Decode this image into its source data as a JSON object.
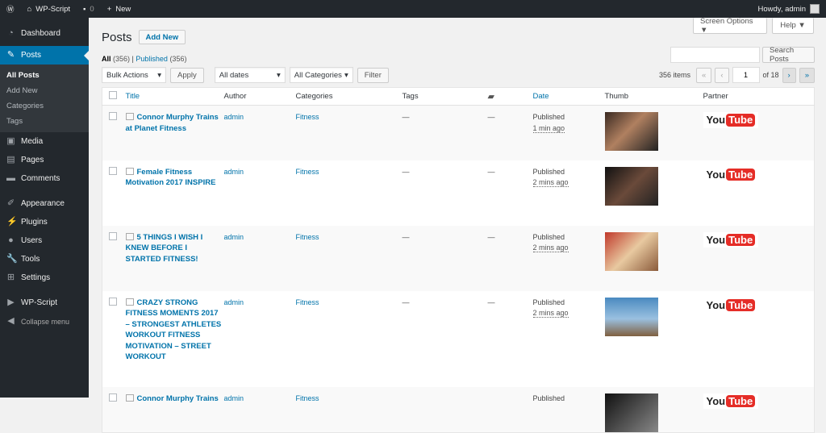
{
  "adminbar": {
    "site": "WP-Script",
    "comments": "0",
    "new": "New",
    "howdy": "Howdy, admin"
  },
  "sidebar": {
    "items": [
      "Dashboard",
      "Posts",
      "Media",
      "Pages",
      "Comments",
      "Appearance",
      "Plugins",
      "Users",
      "Tools",
      "Settings",
      "WP-Script",
      "Collapse menu"
    ],
    "sub": [
      "All Posts",
      "Add New",
      "Categories",
      "Tags"
    ]
  },
  "header": {
    "title": "Posts",
    "add_new": "Add New",
    "screen_options": "Screen Options ▼",
    "help": "Help ▼"
  },
  "filters": {
    "all": "All",
    "all_count": "(356)",
    "published": "Published",
    "published_count": "(356)",
    "bulk": "Bulk Actions",
    "apply": "Apply",
    "dates": "All dates",
    "categories": "All Categories",
    "filter": "Filter",
    "search_placeholder": "",
    "search_btn": "Search Posts",
    "items": "356 items",
    "page": "1",
    "of": "of 18",
    "first": "«",
    "prev": "‹",
    "next": "›",
    "last": "»"
  },
  "columns": {
    "title": "Title",
    "author": "Author",
    "categories": "Categories",
    "tags": "Tags",
    "date": "Date",
    "thumb": "Thumb",
    "partner": "Partner"
  },
  "rows": [
    {
      "title": "Connor Murphy Trains at Planet Fitness",
      "author": "admin",
      "category": "Fitness",
      "tags": "—",
      "comments": "—",
      "status": "Published",
      "time": "1 min ago",
      "partner": "You",
      "partner2": "Tube"
    },
    {
      "title": "Female Fitness Motivation 2017 INSPIRE",
      "author": "admin",
      "category": "Fitness",
      "tags": "—",
      "comments": "—",
      "status": "Published",
      "time": "2 mins ago",
      "partner": "You",
      "partner2": "Tube"
    },
    {
      "title": "5 THINGS I WISH I KNEW BEFORE I STARTED FITNESS!",
      "author": "admin",
      "category": "Fitness",
      "tags": "—",
      "comments": "—",
      "status": "Published",
      "time": "2 mins ago",
      "partner": "You",
      "partner2": "Tube"
    },
    {
      "title": "CRAZY STRONG FITNESS MOMENTS 2017 – STRONGEST ATHLETES WORKOUT FITNESS MOTIVATION – STREET WORKOUT",
      "author": "admin",
      "category": "Fitness",
      "tags": "—",
      "comments": "—",
      "status": "Published",
      "time": "2 mins ago",
      "partner": "You",
      "partner2": "Tube"
    },
    {
      "title": "Connor Murphy Trains",
      "author": "admin",
      "category": "Fitness",
      "tags": "",
      "comments": "",
      "status": "Published",
      "time": "",
      "partner": "You",
      "partner2": "Tube"
    }
  ]
}
